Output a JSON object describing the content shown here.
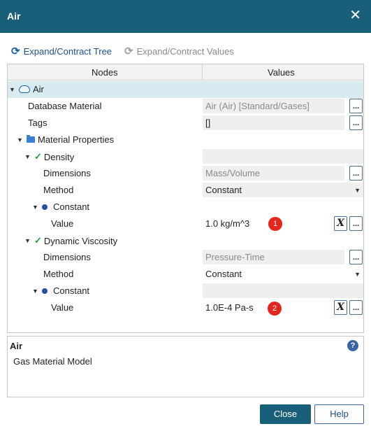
{
  "window": {
    "title": "Air",
    "close_icon": "close-icon"
  },
  "toolbar": {
    "expand_tree": "Expand/Contract Tree",
    "expand_values": "Expand/Contract Values"
  },
  "tree": {
    "headers": {
      "nodes": "Nodes",
      "values": "Values"
    },
    "rows": {
      "air": {
        "label": "Air"
      },
      "database_material": {
        "label": "Database Material",
        "value": "Air (Air) [Standard/Gases]"
      },
      "tags": {
        "label": "Tags",
        "value": "[]"
      },
      "material_properties": {
        "label": "Material Properties"
      },
      "density": {
        "label": "Density"
      },
      "density_dimensions": {
        "label": "Dimensions",
        "value": "Mass/Volume"
      },
      "density_method": {
        "label": "Method",
        "value": "Constant"
      },
      "density_constant": {
        "label": "Constant"
      },
      "density_value": {
        "label": "Value",
        "value": "1.0 kg/m^3",
        "badge": "1"
      },
      "viscosity": {
        "label": "Dynamic Viscosity"
      },
      "viscosity_dimensions": {
        "label": "Dimensions",
        "value": "Pressure-Time"
      },
      "viscosity_method": {
        "label": "Method",
        "value": "Constant"
      },
      "viscosity_constant": {
        "label": "Constant"
      },
      "viscosity_value": {
        "label": "Value",
        "value": "1.0E-4 Pa-s",
        "badge": "2"
      }
    },
    "buttons": {
      "ellipsis": "...",
      "expression": "X"
    }
  },
  "description": {
    "title": "Air",
    "text": "Gas Material Model",
    "help_icon": "?"
  },
  "footer": {
    "close": "Close",
    "help": "Help"
  },
  "colors": {
    "accent": "#1a5f7a",
    "badge": "#e3261e",
    "check": "#1f9c3a",
    "selected_row": "#d8ebf0"
  }
}
